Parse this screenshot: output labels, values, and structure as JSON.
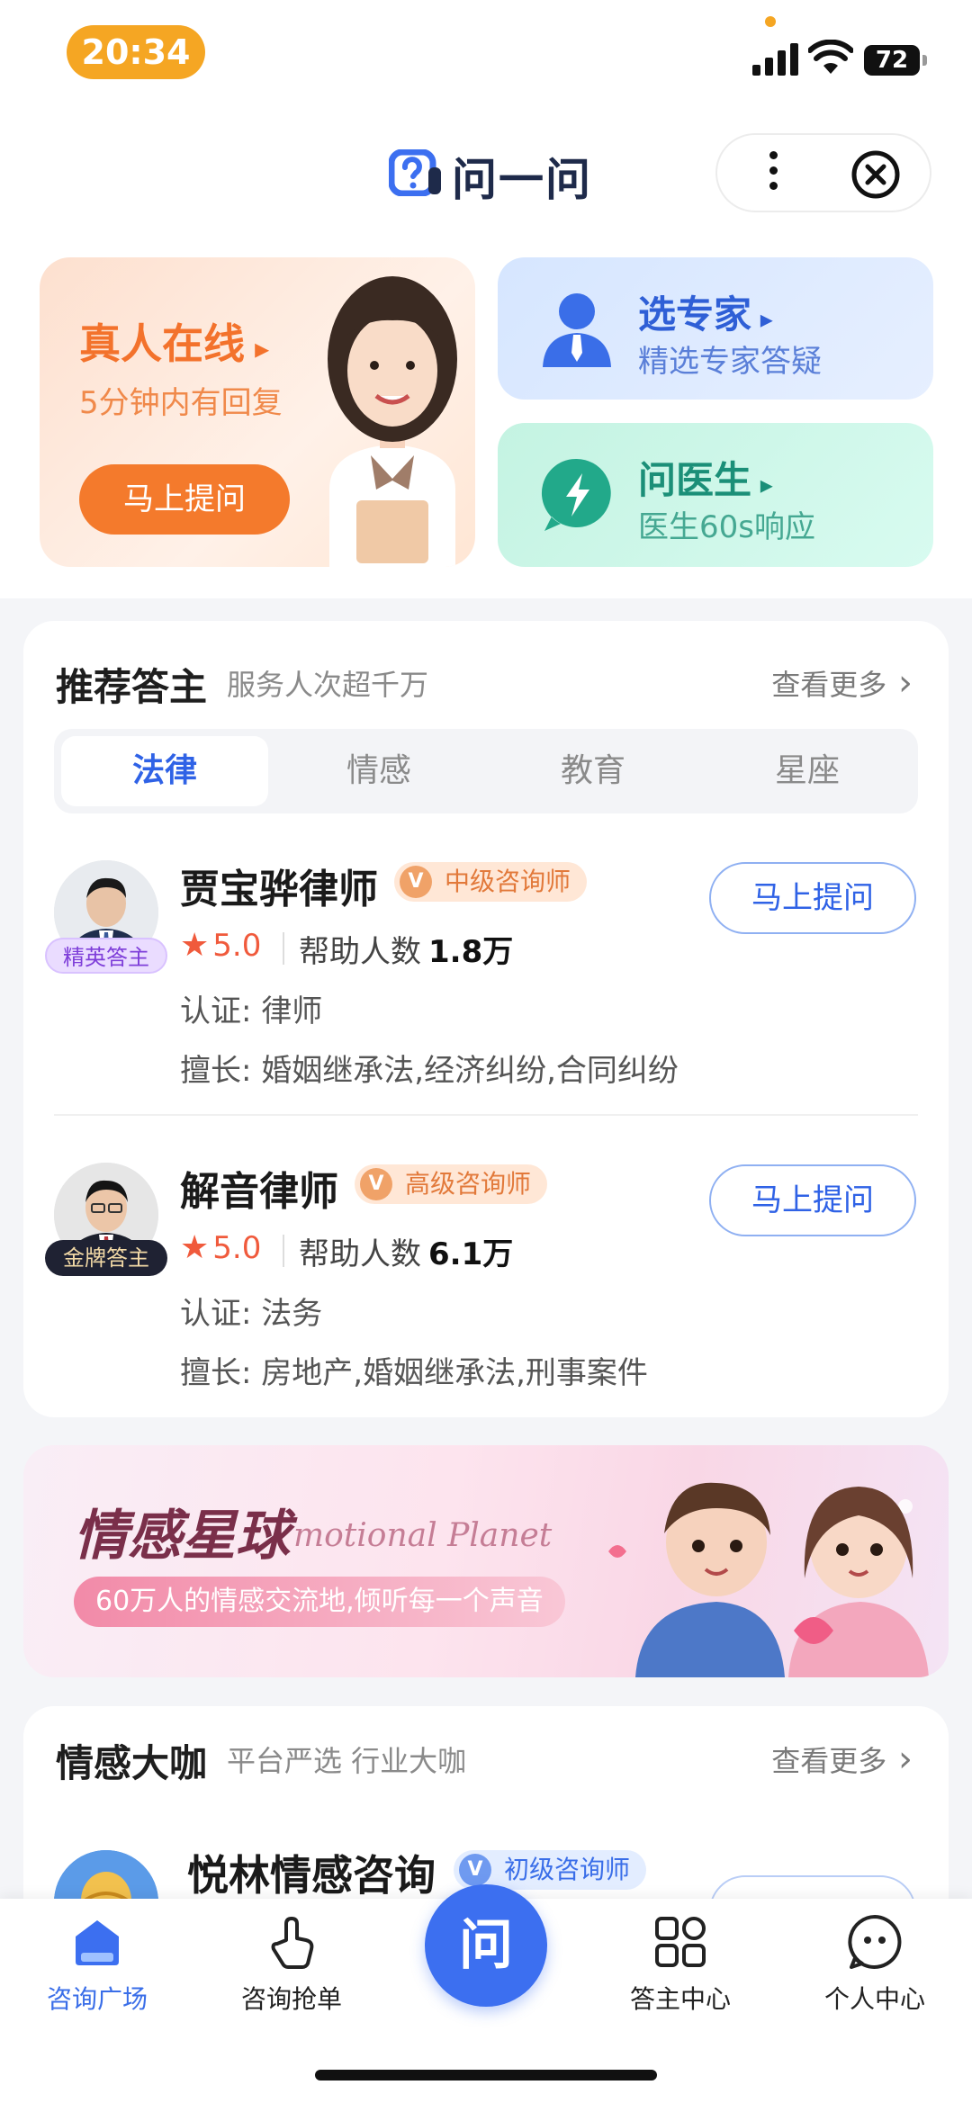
{
  "status_bar": {
    "time": "20:34",
    "battery": "72"
  },
  "header": {
    "app_title": "问一问"
  },
  "feature_cards": {
    "live": {
      "title": "真人在线",
      "subtitle": "5分钟内有回复",
      "button": "马上提问"
    },
    "expert": {
      "title": "选专家",
      "subtitle": "精选专家答疑"
    },
    "doctor": {
      "title": "问医生",
      "subtitle": "医生60s响应"
    }
  },
  "recommended": {
    "title": "推荐答主",
    "subtitle": "服务人次超千万",
    "more": "查看更多",
    "tabs": [
      "法律",
      "情感",
      "教育",
      "星座"
    ],
    "experts": [
      {
        "name": "贾宝骅律师",
        "badge": "精英答主",
        "level": "中级咨询师",
        "rating": "5.0",
        "help_label": "帮助人数",
        "help_count": "1.8万",
        "cert": "认证: 律师",
        "skills": "擅长: 婚姻继承法,经济纠纷,合同纠纷",
        "button": "马上提问"
      },
      {
        "name": "解音律师",
        "badge": "金牌答主",
        "level": "高级咨询师",
        "rating": "5.0",
        "help_label": "帮助人数",
        "help_count": "6.1万",
        "cert": "认证: 法务",
        "skills": "擅长: 房地产,婚姻继承法,刑事案件",
        "button": "马上提问"
      }
    ]
  },
  "banner": {
    "title": "情感星球",
    "title_en": "motional Planet",
    "subtitle": "60万人的情感交流地,倾听每一个声音"
  },
  "emotion_section": {
    "title": "情感大咖",
    "subtitle": "平台严选 行业大咖",
    "more": "查看更多",
    "first_name": "悦林情感咨询",
    "first_level": "初级咨询师"
  },
  "bottom_nav": {
    "items": [
      "咨询广场",
      "咨询抢单",
      "答主中心",
      "个人中心"
    ],
    "center": "问"
  },
  "colors": {
    "accent_blue": "#3c6ff0",
    "accent_orange": "#f47a2c",
    "status_orange": "#f5a623"
  }
}
